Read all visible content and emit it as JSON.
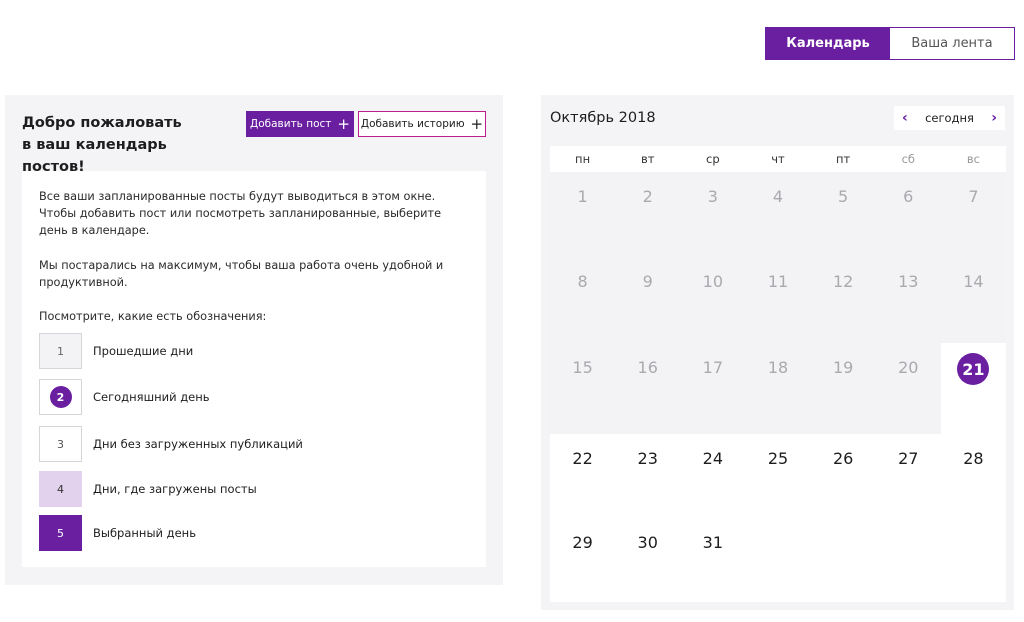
{
  "view_toggle": {
    "calendar_label": "Календарь",
    "feed_label": "Ваша лента"
  },
  "colors": {
    "accent": "#6a1fa0",
    "story_border": "#b8208a",
    "loaded_day": "#e3d2ee",
    "past_bg": "#f3f3f5"
  },
  "welcome": {
    "line1": "Добро пожаловать",
    "line2": "в ваш календарь постов!"
  },
  "buttons": {
    "add_post": "Добавить пост",
    "add_story": "Добавить историю"
  },
  "info": {
    "p1": "Все ваши запланированные посты будут выводиться в этом окне. Чтобы добавить пост или посмотреть запланированные, выберите день в календаре.",
    "p2": "Мы постарались на максимум, чтобы ваша работа очень удобной и продуктивной.",
    "p3": "Посмотрите, какие есть обозначения:"
  },
  "legend": [
    {
      "num": "1",
      "label": "Прошедшие дни"
    },
    {
      "num": "2",
      "label": "Сегодняшний день"
    },
    {
      "num": "3",
      "label": "Дни без загруженных публикаций"
    },
    {
      "num": "4",
      "label": "Дни, где загружены посты"
    },
    {
      "num": "5",
      "label": "Выбранный день"
    }
  ],
  "calendar": {
    "title": "Октябрь 2018",
    "today_label": "сегодня",
    "prev_icon": "chevron-left-icon",
    "next_icon": "chevron-right-icon",
    "weekdays": [
      "пн",
      "вт",
      "ср",
      "чт",
      "пт",
      "сб",
      "вс"
    ],
    "today": 21,
    "weeks": [
      [
        "1",
        "2",
        "3",
        "4",
        "5",
        "6",
        "7"
      ],
      [
        "8",
        "9",
        "10",
        "11",
        "12",
        "13",
        "14"
      ],
      [
        "15",
        "16",
        "17",
        "18",
        "19",
        "20",
        "21"
      ],
      [
        "22",
        "23",
        "24",
        "25",
        "26",
        "27",
        "28"
      ],
      [
        "29",
        "30",
        "31",
        "",
        "",
        "",
        ""
      ]
    ]
  }
}
